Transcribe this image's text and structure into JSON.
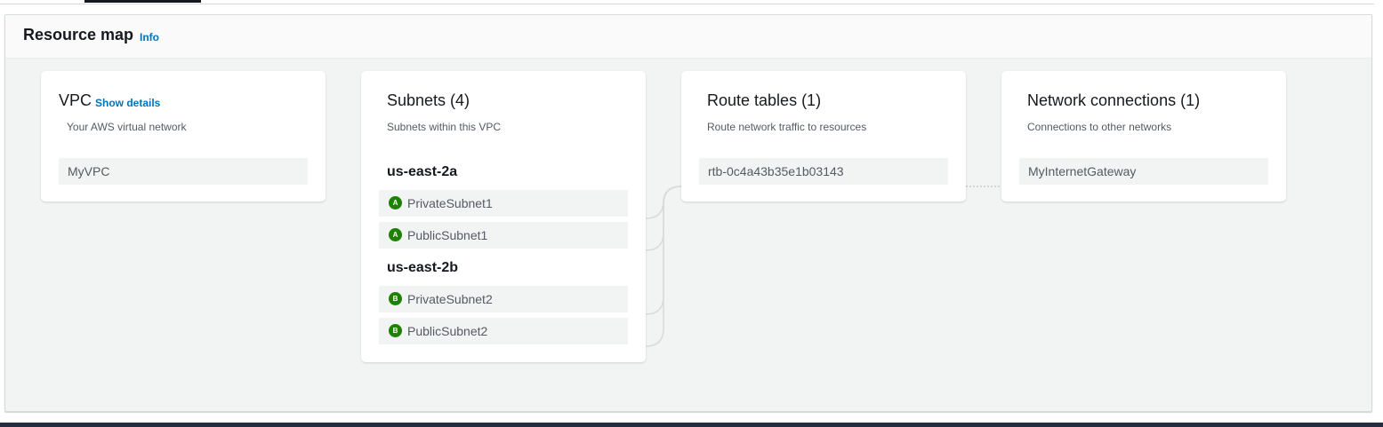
{
  "panel": {
    "title": "Resource map",
    "info_link": "Info"
  },
  "vpc": {
    "title": "VPC",
    "details_link": "Show details",
    "description": "Your AWS virtual network",
    "item": "MyVPC"
  },
  "subnets": {
    "title": "Subnets (4)",
    "description": "Subnets within this VPC",
    "zones": [
      {
        "name": "us-east-2a",
        "badge": "A",
        "items": [
          "PrivateSubnet1",
          "PublicSubnet1"
        ]
      },
      {
        "name": "us-east-2b",
        "badge": "B",
        "items": [
          "PrivateSubnet2",
          "PublicSubnet2"
        ]
      }
    ]
  },
  "route_tables": {
    "title": "Route tables (1)",
    "description": "Route network traffic to resources",
    "items": [
      "rtb-0c4a43b35e1b03143"
    ]
  },
  "network_connections": {
    "title": "Network connections (1)",
    "description": "Connections to other networks",
    "items": [
      "MyInternetGateway"
    ]
  },
  "colors": {
    "link": "#0073bb",
    "badge": "#1d8102",
    "connector": "#d5dbdb"
  }
}
